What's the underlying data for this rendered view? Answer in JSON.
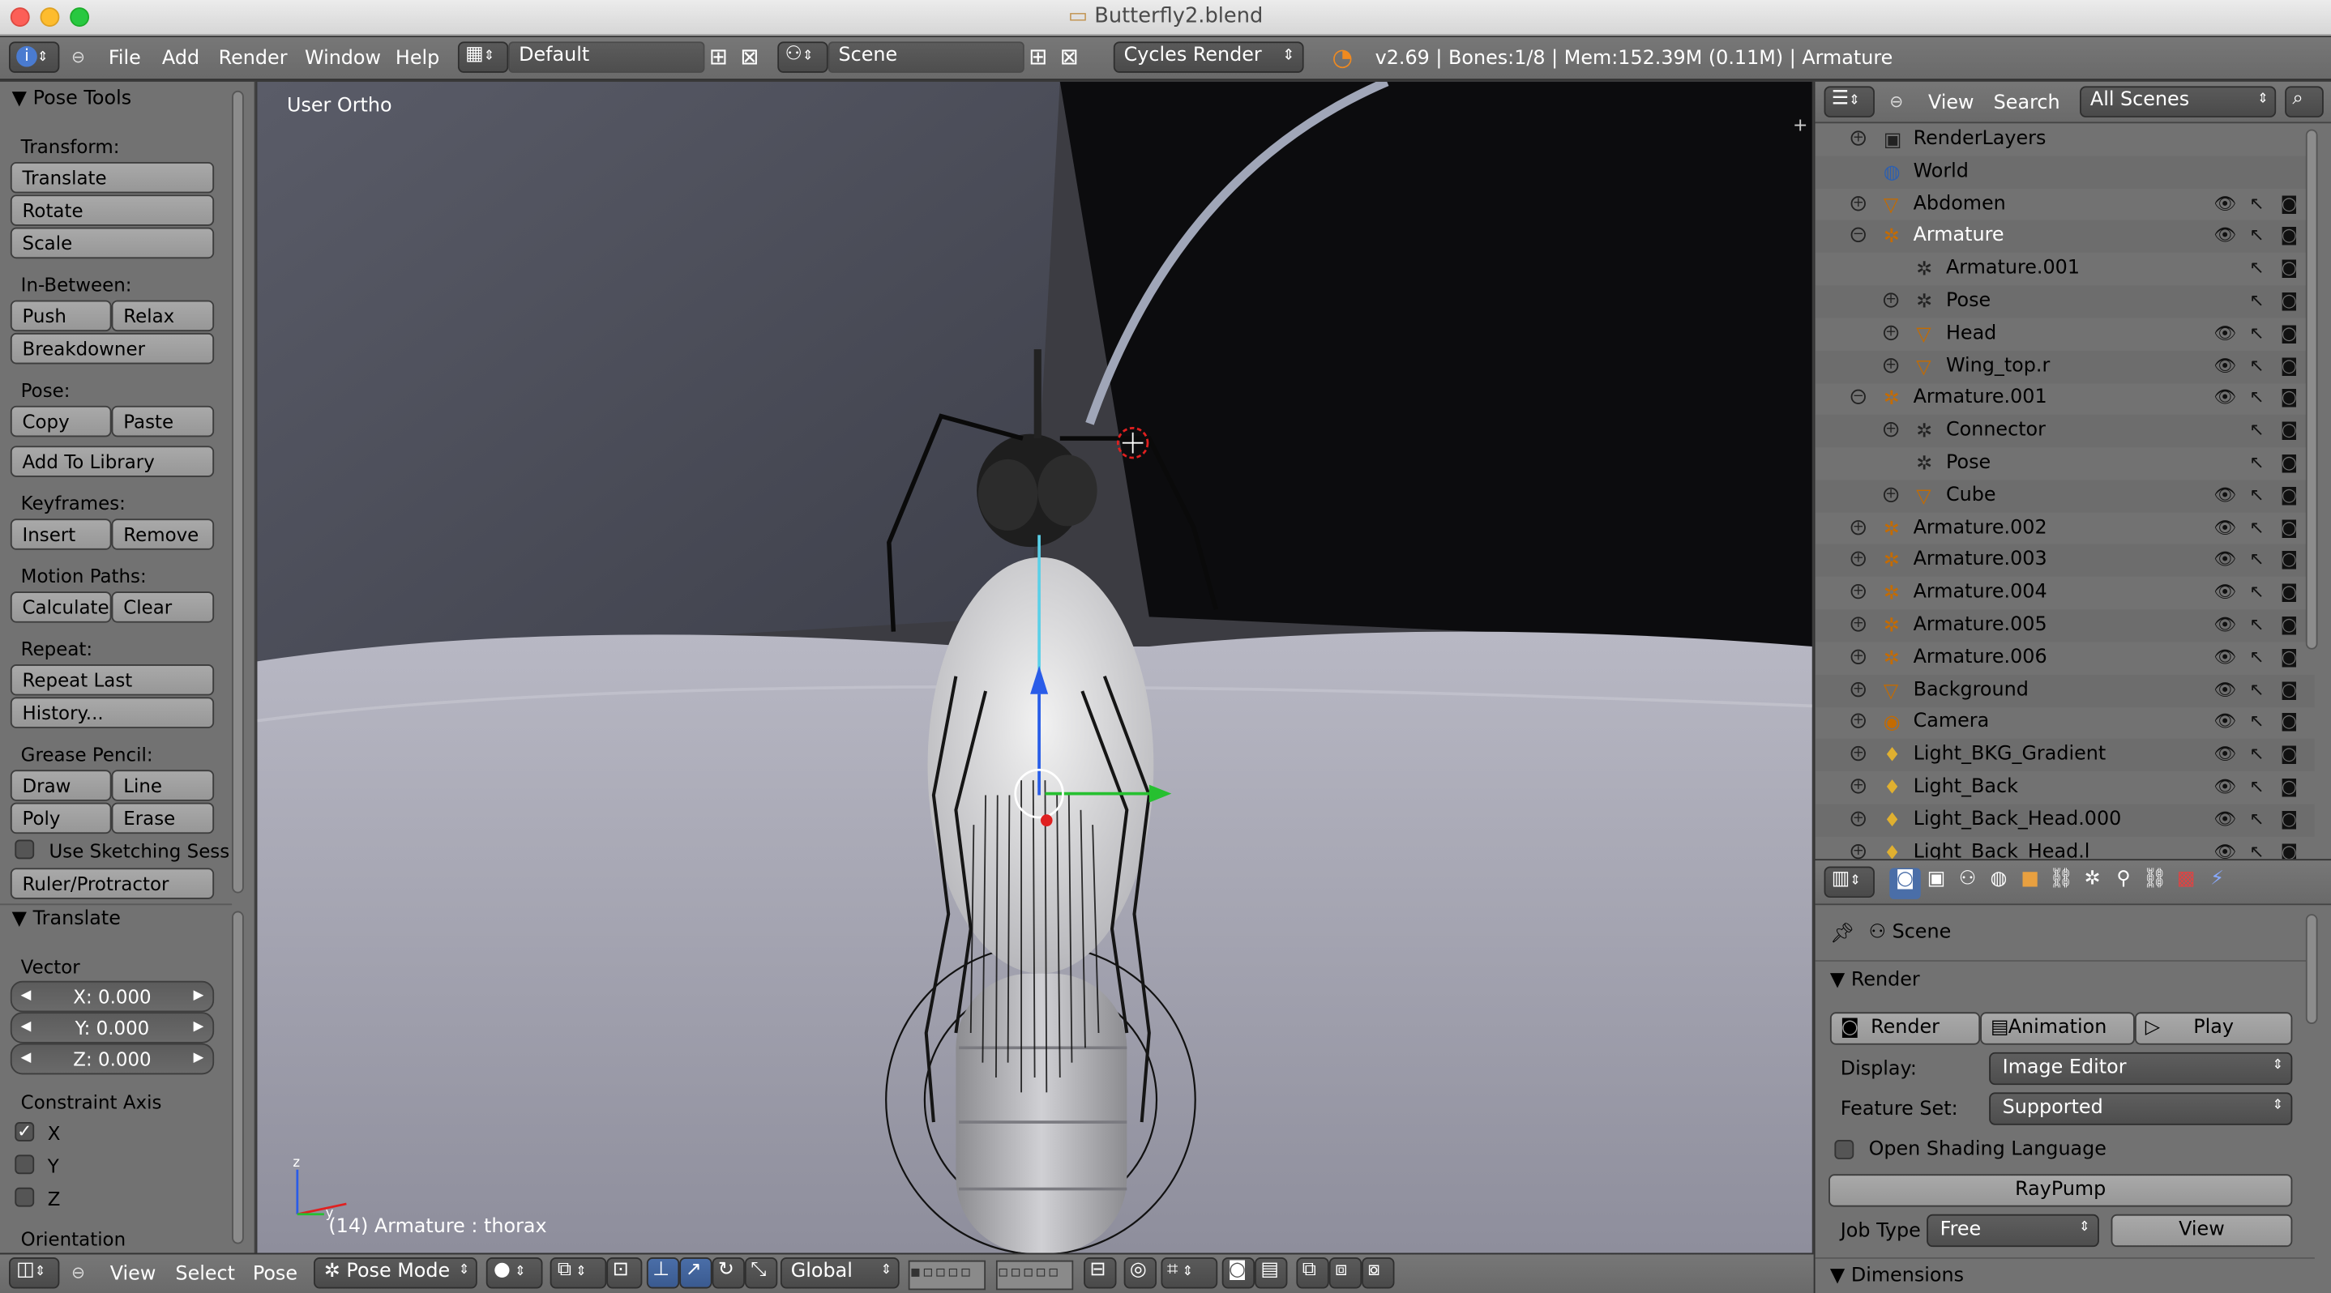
{
  "window": {
    "title": "Butterfly2.blend"
  },
  "info": {
    "menus": [
      "File",
      "Add",
      "Render",
      "Window",
      "Help"
    ],
    "layout": "Default",
    "scene": "Scene",
    "engine": "Cycles Render",
    "stats": "v2.69 | Bones:1/8  | Mem:152.39M (0.11M) | Armature"
  },
  "toolshelf": {
    "header": "Pose Tools",
    "transform_label": "Transform:",
    "translate": "Translate",
    "rotate": "Rotate",
    "scale": "Scale",
    "inbetween_label": "In-Between:",
    "push": "Push",
    "relax": "Relax",
    "breakdowner": "Breakdowner",
    "pose_label": "Pose:",
    "copy": "Copy",
    "paste": "Paste",
    "add_to_library": "Add To Library",
    "keyframes_label": "Keyframes:",
    "insert": "Insert",
    "remove": "Remove",
    "motion_label": "Motion Paths:",
    "calculate": "Calculate",
    "clear": "Clear",
    "repeat_label": "Repeat:",
    "repeat_last": "Repeat Last",
    "history": "History...",
    "grease_label": "Grease Pencil:",
    "draw": "Draw",
    "line": "Line",
    "poly": "Poly",
    "erase": "Erase",
    "sketching": "Use Sketching Sess",
    "ruler": "Ruler/Protractor",
    "op_header": "Translate",
    "vector_label": "Vector",
    "x": "X: 0.000",
    "y": "Y: 0.000",
    "z": "Z: 0.000",
    "constraint_label": "Constraint Axis",
    "cx": "X",
    "cy": "Y",
    "cz": "Z",
    "constraint_x_checked": true,
    "orientation_label": "Orientation"
  },
  "viewport": {
    "view_name": "User Ortho",
    "status": "(14) Armature : thorax"
  },
  "bottombar": {
    "menus": [
      "View",
      "Select",
      "Pose"
    ],
    "mode": "Pose Mode",
    "orientation": "Global"
  },
  "outliner": {
    "menus": [
      "View",
      "Search"
    ],
    "filter": "All Scenes",
    "rows": [
      {
        "label": "RenderLayers",
        "indent": 1,
        "icon": "render-layers-icon",
        "glyph": "▣",
        "exp": "+",
        "vis": false
      },
      {
        "label": "World",
        "indent": 1,
        "icon": "world-icon",
        "glyph": "◍",
        "exp": "",
        "vis": false
      },
      {
        "label": "Abdomen",
        "indent": 1,
        "icon": "mesh-icon",
        "glyph": "▽",
        "exp": "+",
        "vis": true
      },
      {
        "label": "Armature",
        "indent": 1,
        "icon": "armature-icon",
        "glyph": "✲",
        "exp": "−",
        "vis": true,
        "active": true
      },
      {
        "label": "Armature.001",
        "indent": 2,
        "icon": "armature-data-icon",
        "glyph": "✲",
        "exp": "",
        "vis": false
      },
      {
        "label": "Pose",
        "indent": 2,
        "icon": "pose-icon",
        "glyph": "✲",
        "exp": "+",
        "vis": false
      },
      {
        "label": "Head",
        "indent": 2,
        "icon": "mesh-icon",
        "glyph": "▽",
        "exp": "+",
        "vis": true
      },
      {
        "label": "Wing_top.r",
        "indent": 2,
        "icon": "mesh-icon",
        "glyph": "▽",
        "exp": "+",
        "vis": true
      },
      {
        "label": "Armature.001",
        "indent": 1,
        "icon": "armature-icon",
        "glyph": "✲",
        "exp": "−",
        "vis": true
      },
      {
        "label": "Connector",
        "indent": 2,
        "icon": "armature-data-icon",
        "glyph": "✲",
        "exp": "+",
        "vis": false
      },
      {
        "label": "Pose",
        "indent": 2,
        "icon": "pose-icon",
        "glyph": "✲",
        "exp": "",
        "vis": false
      },
      {
        "label": "Cube",
        "indent": 2,
        "icon": "mesh-icon",
        "glyph": "▽",
        "exp": "+",
        "vis": true
      },
      {
        "label": "Armature.002",
        "indent": 1,
        "icon": "armature-icon",
        "glyph": "✲",
        "exp": "+",
        "vis": true
      },
      {
        "label": "Armature.003",
        "indent": 1,
        "icon": "armature-icon",
        "glyph": "✲",
        "exp": "+",
        "vis": true
      },
      {
        "label": "Armature.004",
        "indent": 1,
        "icon": "armature-icon",
        "glyph": "✲",
        "exp": "+",
        "vis": true
      },
      {
        "label": "Armature.005",
        "indent": 1,
        "icon": "armature-icon",
        "glyph": "✲",
        "exp": "+",
        "vis": true
      },
      {
        "label": "Armature.006",
        "indent": 1,
        "icon": "armature-icon",
        "glyph": "✲",
        "exp": "+",
        "vis": true
      },
      {
        "label": "Background",
        "indent": 1,
        "icon": "mesh-icon",
        "glyph": "▽",
        "exp": "+",
        "vis": true
      },
      {
        "label": "Camera",
        "indent": 1,
        "icon": "camera-icon",
        "glyph": "◉",
        "exp": "+",
        "vis": true
      },
      {
        "label": "Light_BKG_Gradient",
        "indent": 1,
        "icon": "lamp-icon",
        "glyph": "♦",
        "exp": "+",
        "vis": true
      },
      {
        "label": "Light_Back",
        "indent": 1,
        "icon": "lamp-icon",
        "glyph": "♦",
        "exp": "+",
        "vis": true
      },
      {
        "label": "Light_Back_Head.000",
        "indent": 1,
        "icon": "lamp-icon",
        "glyph": "♦",
        "exp": "+",
        "vis": true
      },
      {
        "label": "Light_Back_Head.l",
        "indent": 1,
        "icon": "lamp-icon",
        "glyph": "♦",
        "exp": "+",
        "vis": true
      }
    ]
  },
  "properties": {
    "context": "Scene",
    "render_panel": "Render",
    "render_btn": "Render",
    "animation_btn": "Animation",
    "play_btn": "Play",
    "display_label": "Display:",
    "display_value": "Image Editor",
    "feature_label": "Feature Set:",
    "feature_value": "Supported",
    "osl_label": "Open Shading Language",
    "raypump": "RayPump",
    "jobtype_label": "Job Type",
    "jobtype_value": "Free",
    "view_btn": "View",
    "dimensions_panel": "Dimensions"
  },
  "colors": {
    "accent_orange": "#e8842a",
    "selected_text": "#ffffff",
    "viewport_bg": "#3c3c42"
  }
}
